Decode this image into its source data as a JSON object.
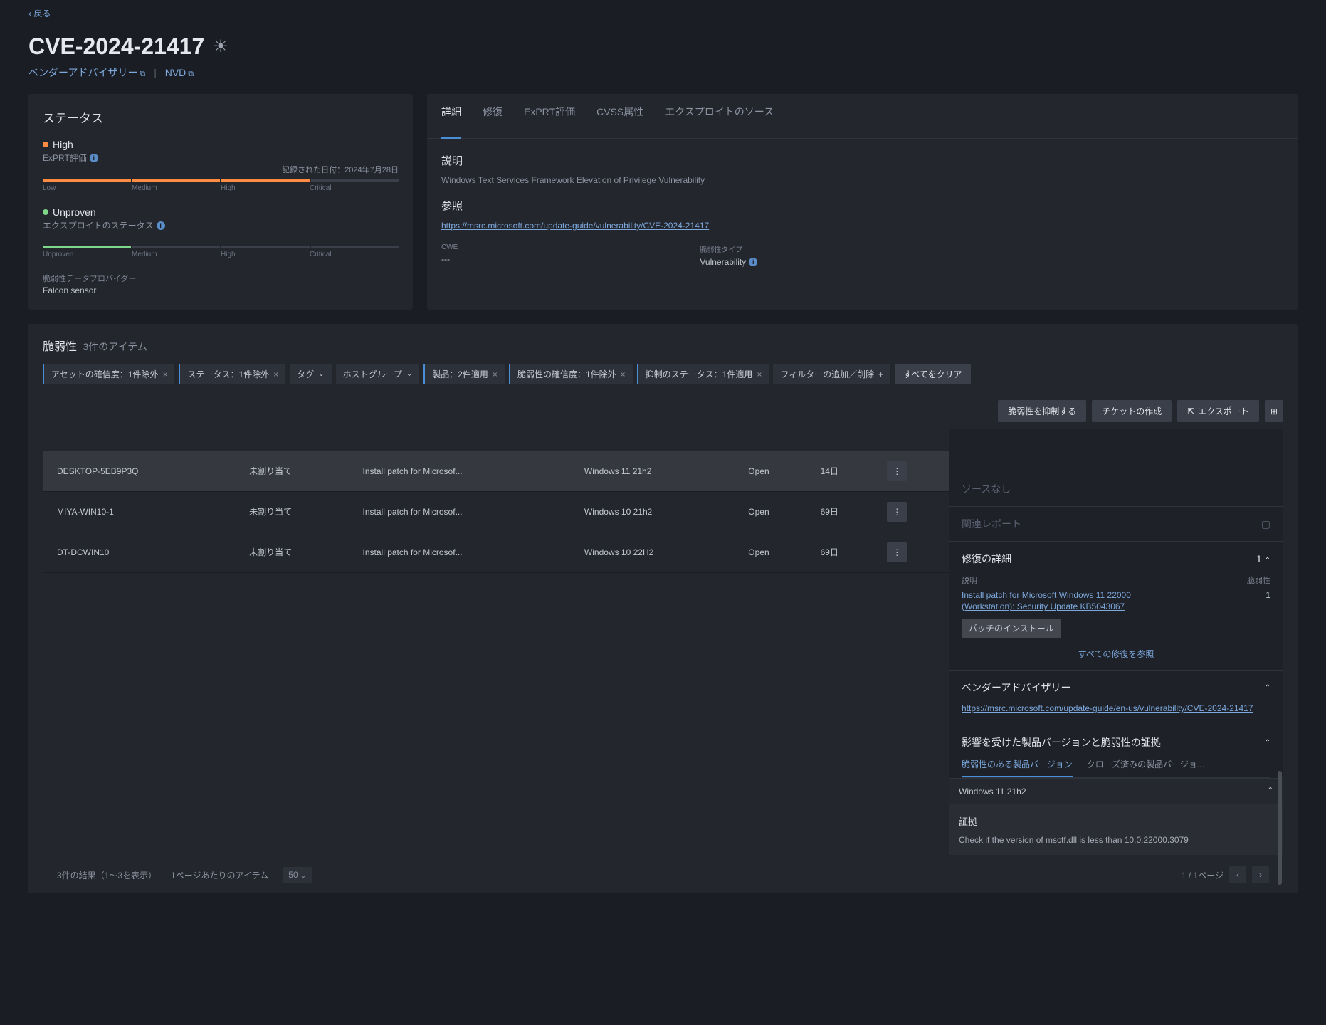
{
  "back": "戻る",
  "title": "CVE-2024-21417",
  "sublinks": {
    "advisory": "ベンダーアドバイザリー",
    "nvd": "NVD"
  },
  "status": {
    "heading": "ステータス",
    "exprt": {
      "level": "High",
      "label": "ExPRT評価",
      "date_label": "記録された日付：",
      "date": "2024年7月28日"
    },
    "exploit": {
      "level": "Unproven",
      "label": "エクスプロイトのステータス"
    },
    "bar_labels": {
      "l1": "Low",
      "l2": "Medium",
      "l3": "High",
      "l4": "Critical"
    },
    "exploit_bar_labels": {
      "l1": "Unproven",
      "l2": "Medium",
      "l3": "High",
      "l4": "Critical"
    },
    "provider_label": "脆弱性データプロバイダー",
    "provider_value": "Falcon sensor"
  },
  "tabs": {
    "t1": "詳細",
    "t2": "修復",
    "t3": "ExPRT評価",
    "t4": "CVSS属性",
    "t5": "エクスプロイトのソース"
  },
  "details": {
    "desc_heading": "説明",
    "description": "Windows Text Services Framework Elevation of Privilege Vulnerability",
    "ref_heading": "参照",
    "ref_link": "https://msrc.microsoft.com/update-guide/vulnerability/CVE-2024-21417",
    "cwe_label": "CWE",
    "cwe_value": "---",
    "type_label": "脆弱性タイプ",
    "type_value": "Vulnerability"
  },
  "vuln": {
    "heading": "脆弱性",
    "count": "3件のアイテム",
    "filters": {
      "f1": "アセットの確信度：1件除外",
      "f2": "ステータス：1件除外",
      "f3": "タグ",
      "f4": "ホストグループ",
      "f5": "製品：2件適用",
      "f6": "脆弱性の確信度：1件除外",
      "f7": "抑制のステータス：1件適用",
      "f8": "フィルターの追加／削除",
      "clear": "すべてをクリア"
    },
    "actions": {
      "a1": "脆弱性を抑制する",
      "a2": "チケットの作成",
      "a3": "エクスポート"
    },
    "rows": [
      {
        "host": "DESKTOP-5EB9P3Q",
        "assignee": "未割り当て",
        "action": "Install patch for Microsof...",
        "product": "Windows 11 21h2",
        "status": "Open",
        "age": "14日"
      },
      {
        "host": "MIYA-WIN10-1",
        "assignee": "未割り当て",
        "action": "Install patch for Microsof...",
        "product": "Windows 10 21h2",
        "status": "Open",
        "age": "69日"
      },
      {
        "host": "DT-DCWIN10",
        "assignee": "未割り当て",
        "action": "Install patch for Microsof...",
        "product": "Windows 10 22H2",
        "status": "Open",
        "age": "69日"
      }
    ]
  },
  "detail_panel": {
    "source": "ソースなし",
    "reports": "関連レポート",
    "remediation": {
      "heading": "修復の詳細",
      "count": "1",
      "desc_label": "説明",
      "vuln_label": "脆弱性",
      "link1": "Install patch for Microsoft Windows 11 22000",
      "link2": "(Workstation): Security Update KB5043067",
      "vuln_count": "1",
      "patch_btn": "パッチのインストール",
      "view_all": "すべての修復を参照"
    },
    "advisory": {
      "heading": "ベンダーアドバイザリー",
      "link": "https://msrc.microsoft.com/update-guide/en-us/vulnerability/CVE-2024-21417"
    },
    "affected": {
      "heading": "影響を受けた製品バージョンと脆弱性の証拠",
      "tab1": "脆弱性のある製品バージョン",
      "tab2": "クローズ済みの製品バージョ...",
      "product": "Windows 11 21h2",
      "evidence_heading": "証拠",
      "evidence_text": "Check if the version of msctf.dll is less than 10.0.22000.3079"
    }
  },
  "footer": {
    "results": "3件の結果（1～3を表示）",
    "per_page_label": "1ページあたりのアイテム",
    "per_page": "50",
    "page_info": "1 / 1ページ"
  }
}
